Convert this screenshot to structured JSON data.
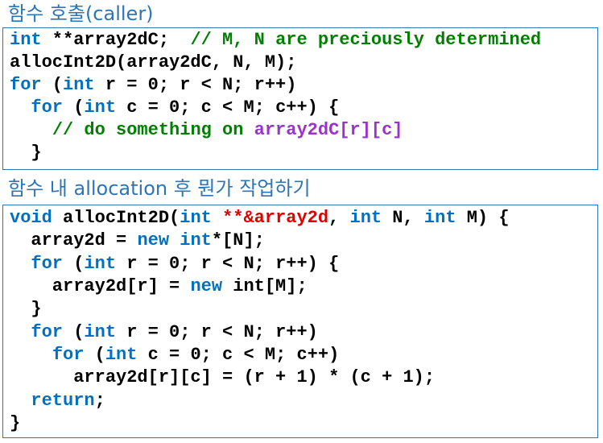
{
  "section1": {
    "title": "함수 호출(caller)",
    "code": {
      "l1_kw": "int",
      "l1_rest": " **array2dC;  ",
      "l1_comment": "// M, N are preciously determined",
      "l2": "allocInt2D(array2dC, N, M);",
      "l3_kw1": "for",
      "l3_a": " (",
      "l3_kw2": "int",
      "l3_b": " r = 0; r < N; r++)",
      "l4_indent": "  ",
      "l4_kw1": "for",
      "l4_a": " (",
      "l4_kw2": "int",
      "l4_b": " c = 0; c < M; c++) {",
      "l5_indent": "    ",
      "l5_comment": "// do something on ",
      "l5_var": "array2dC[r][c]",
      "l6": "  }"
    }
  },
  "section2": {
    "title": "함수 내 allocation 후 뭔가 작업하기",
    "code": {
      "l1_kw1": "void",
      "l1_a": " allocInt2D(",
      "l1_kw2": "int",
      "l1_b": " ",
      "l1_ptr": "**&array2d",
      "l1_c": ", ",
      "l1_kw3": "int",
      "l1_d": " N, ",
      "l1_kw4": "int",
      "l1_e": " M) {",
      "l2_a": "  array2d = ",
      "l2_kw1": "new",
      "l2_b": " ",
      "l2_kw2": "int",
      "l2_c": "*[N];",
      "l3_indent": "  ",
      "l3_kw1": "for",
      "l3_a": " (",
      "l3_kw2": "int",
      "l3_b": " r = 0; r < N; r++) {",
      "l4_a": "    array2d[r] = ",
      "l4_kw": "new",
      "l4_b": " int[M];",
      "l5": "  }",
      "l6_indent": "  ",
      "l6_kw1": "for",
      "l6_a": " (",
      "l6_kw2": "int",
      "l6_b": " r = 0; r < N; r++)",
      "l7_indent": "    ",
      "l7_kw1": "for",
      "l7_a": " (",
      "l7_kw2": "int",
      "l7_b": " c = 0; c < M; c++)",
      "l8": "      array2d[r][c] = (r + 1) * (c + 1);",
      "l9_indent": "  ",
      "l9_kw": "return",
      "l9_a": ";",
      "l10": "}"
    }
  },
  "colors": {
    "keyword": "#0070c0",
    "comment": "#008000",
    "highlight_var": "#9933cc",
    "highlight_param": "#e00000",
    "title": "#2e75b6",
    "border": "#2e75b6"
  }
}
